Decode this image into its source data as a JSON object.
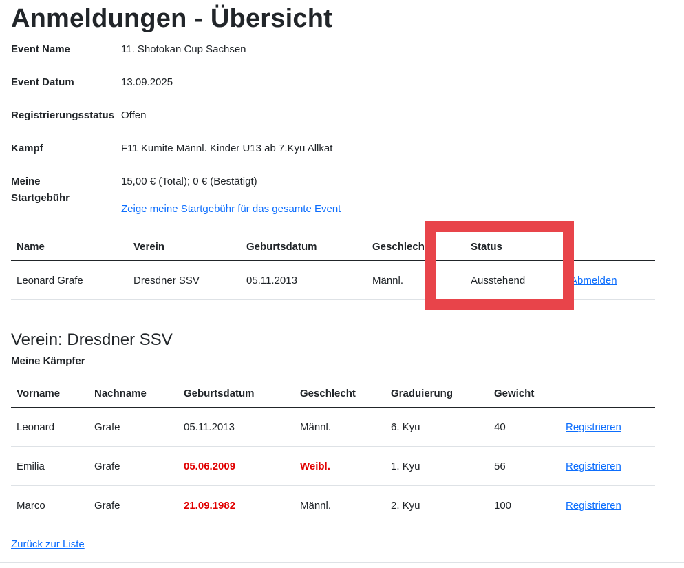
{
  "page_title": "Anmeldungen - Übersicht",
  "event": {
    "name_label": "Event Name",
    "name_value": "11. Shotokan Cup Sachsen",
    "date_label": "Event Datum",
    "date_value": "13.09.2025",
    "status_label": "Registrierungsstatus",
    "status_value": "Offen",
    "fight_label": "Kampf",
    "fight_value": "F11 Kumite Männl. Kinder U13 ab 7.Kyu Allkat",
    "fee_label_line1": "Meine",
    "fee_label_line2": "Startgebühr",
    "fee_value": "15,00 € (Total); 0 € (Bestätigt)",
    "fee_link": "Zeige meine Startgebühr für das gesamte Event"
  },
  "registrations": {
    "headers": [
      "Name",
      "Verein",
      "Geburtsdatum",
      "Geschlecht",
      "Status"
    ],
    "rows": [
      {
        "name": "Leonard Grafe",
        "club": "Dresdner SSV",
        "birth": "05.11.2013",
        "gender": "Männl.",
        "status": "Ausstehend",
        "action": "Abmelden"
      }
    ]
  },
  "club": {
    "heading": "Verein: Dresdner SSV",
    "subheading": "Meine Kämpfer",
    "headers": [
      "Vorname",
      "Nachname",
      "Geburtsdatum",
      "Geschlecht",
      "Graduierung",
      "Gewicht"
    ],
    "rows": [
      {
        "first": "Leonard",
        "last": "Grafe",
        "birth": "05.11.2013",
        "gender": "Männl.",
        "grade": "6. Kyu",
        "weight": "40",
        "action": "Registrieren"
      },
      {
        "first": "Emilia",
        "last": "Grafe",
        "birth": "05.06.2009",
        "gender": "Weibl.",
        "grade": "1. Kyu",
        "weight": "56",
        "action": "Registrieren"
      },
      {
        "first": "Marco",
        "last": "Grafe",
        "birth": "21.09.1982",
        "gender": "Männl.",
        "grade": "2. Kyu",
        "weight": "100",
        "action": "Registrieren"
      }
    ]
  },
  "back_link": "Zurück zur Liste",
  "colors": {
    "link": "#0d6efd",
    "warning": "#e00000",
    "highlight": "#e8444a"
  }
}
